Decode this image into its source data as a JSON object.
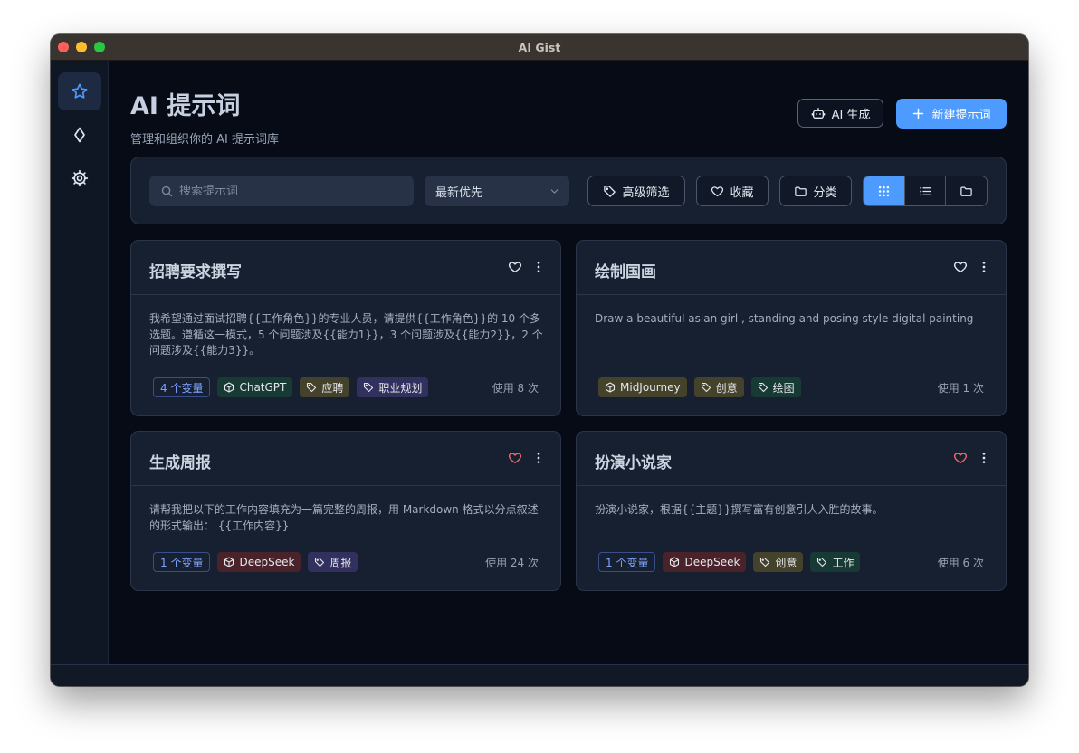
{
  "window": {
    "title": "AI Gist"
  },
  "sidebar": {
    "items": [
      {
        "icon": "star-icon",
        "active": true
      },
      {
        "icon": "diamond-icon",
        "active": false
      },
      {
        "icon": "gear-icon",
        "active": false
      }
    ]
  },
  "header": {
    "title": "AI 提示词",
    "subtitle": "管理和组织你的 AI 提示词库",
    "ai_button": "AI 生成",
    "new_button": "新建提示词",
    "accent": "#4d9bff"
  },
  "toolbar": {
    "search_placeholder": "搜索提示词",
    "sort_value": "最新优先",
    "filter_label": "高级筛选",
    "favorites_label": "收藏",
    "category_label": "分类",
    "active_view": "grid"
  },
  "cards": [
    {
      "title": "招聘要求撰写",
      "favorite": false,
      "description": "我希望通过面试招聘{{工作角色}}的专业人员，请提供{{工作角色}}的 10 个多选题。遵循这一模式，5 个问题涉及{{能力1}}，3 个问题涉及{{能力2}}，2 个问题涉及{{能力3}}。",
      "variables": "4 个变量",
      "model": "ChatGPT",
      "tags": [
        "应聘",
        "职业规划"
      ],
      "usage": "使用 8 次"
    },
    {
      "title": "绘制国画",
      "favorite": false,
      "description": "Draw a beautiful asian girl , standing and posing style digital painting",
      "variables": "",
      "model": "MidJourney",
      "tags": [
        "创意",
        "绘图"
      ],
      "usage": "使用 1 次"
    },
    {
      "title": "生成周报",
      "favorite": true,
      "description": "请帮我把以下的工作内容填充为一篇完整的周报，用 Markdown 格式以分点叙述的形式输出： {{工作内容}}",
      "variables": "1 个变量",
      "model": "DeepSeek",
      "tags": [
        "周报"
      ],
      "usage": "使用 24 次"
    },
    {
      "title": "扮演小说家",
      "favorite": true,
      "description": "扮演小说家，根据{{主题}}撰写富有创意引人入胜的故事。",
      "variables": "1 个变量",
      "model": "DeepSeek",
      "tags": [
        "创意",
        "工作"
      ],
      "usage": "使用 6 次"
    }
  ]
}
